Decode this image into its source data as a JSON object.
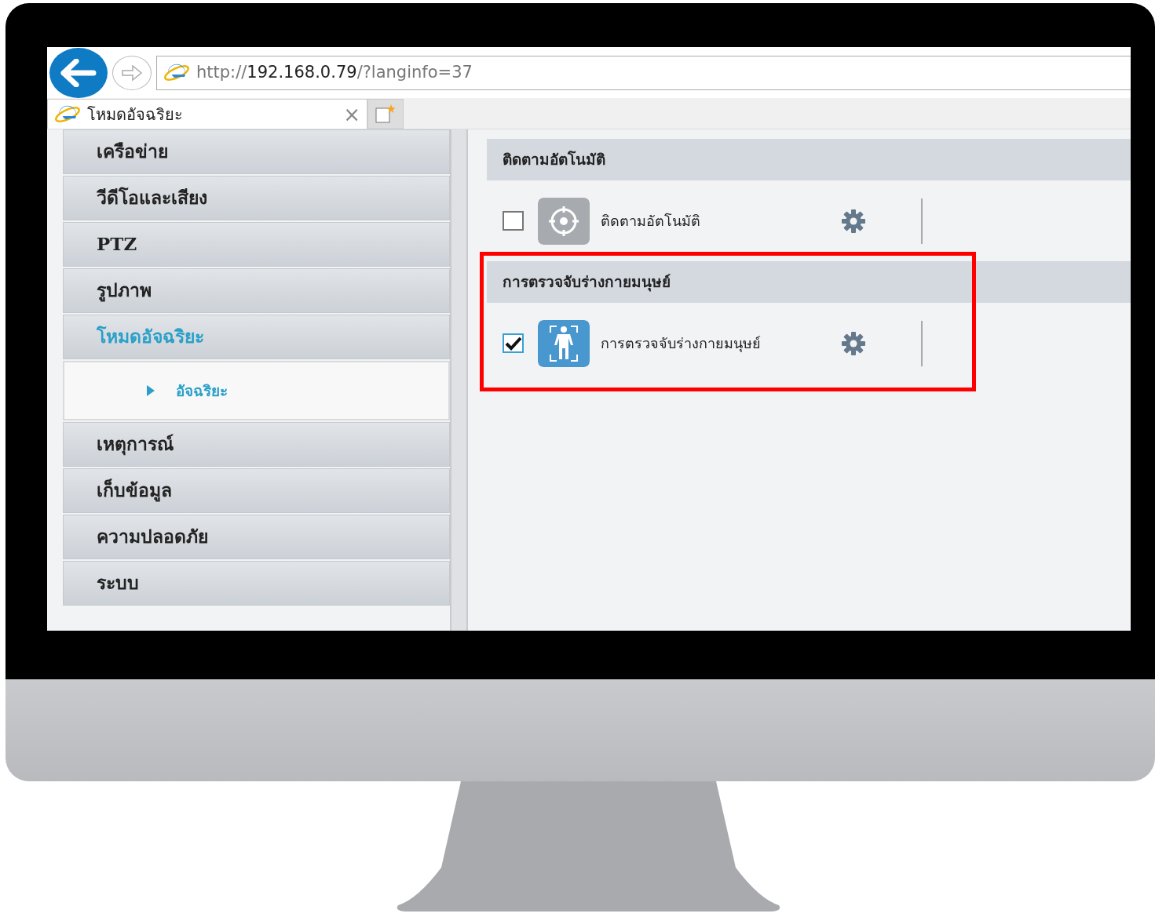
{
  "browser": {
    "url_scheme": "http://",
    "url_host": "192.168.0.79",
    "url_path": "/?langinfo=37",
    "tab": {
      "title": "โหมดอัจฉริยะ",
      "close": "×"
    }
  },
  "sidebar": {
    "items": [
      {
        "label": "เครือข่าย",
        "selected": false
      },
      {
        "label": "วีดีโอและเสียง",
        "selected": false
      },
      {
        "label": "PTZ",
        "selected": false
      },
      {
        "label": "รูปภาพ",
        "selected": false
      },
      {
        "label": "โหมดอัจฉริยะ",
        "selected": true,
        "expanded": true,
        "children": [
          {
            "label": "อัจฉริยะ",
            "selected": true
          }
        ]
      },
      {
        "label": "เหตุการณ์",
        "selected": false
      },
      {
        "label": "เก็บข้อมูล",
        "selected": false
      },
      {
        "label": "ความปลอดภัย",
        "selected": false
      },
      {
        "label": "ระบบ",
        "selected": false
      }
    ]
  },
  "sections": [
    {
      "title": "ติดตามอัตโนมัติ",
      "items": [
        {
          "kind": "tracking",
          "label": "ติดตามอัตโนมัติ",
          "checked": false
        }
      ]
    },
    {
      "title": "การตรวจจับร่างกายมนุษย์",
      "highlighted": true,
      "items": [
        {
          "kind": "human",
          "label": "การตรวจจับร่างกายมนุษย์",
          "checked": true
        }
      ]
    }
  ]
}
